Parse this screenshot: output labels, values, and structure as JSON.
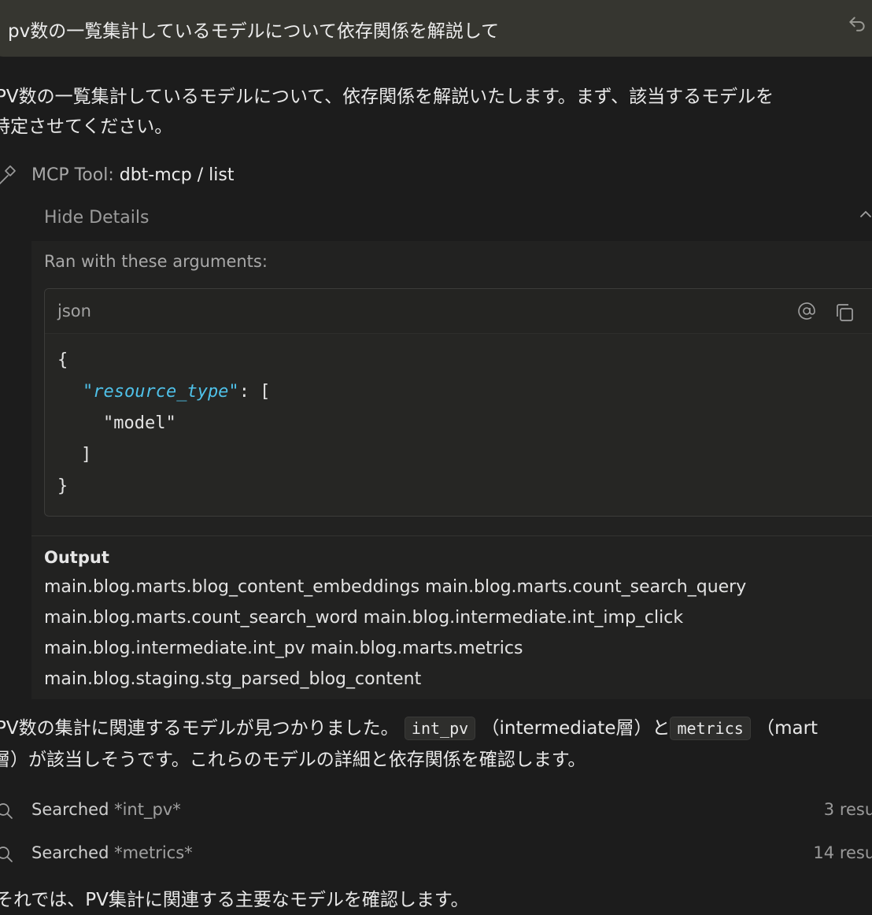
{
  "user_message": "pv数の一覧集計しているモデルについて依存関係を解説して",
  "assistant_intro_line1": "PV数の一覧集計しているモデルについて、依存関係を解説いたします。まず、該当するモデルを",
  "assistant_intro_line2": "特定させてください。",
  "tool_call": {
    "label": "MCP Tool:",
    "name": "dbt-mcp / list",
    "hide_details": "Hide Details",
    "ran_with": "Ran with these arguments:",
    "code_lang": "json",
    "code_lines": [
      "{",
      "\"resource_type\"",
      ": [",
      "\"model\"",
      "]",
      "}"
    ],
    "output_title": "Output",
    "output_lines": [
      "main.blog.marts.blog_content_embeddings main.blog.marts.count_search_query",
      "main.blog.marts.count_search_word main.blog.intermediate.int_imp_click",
      "main.blog.intermediate.int_pv main.blog.marts.metrics",
      "main.blog.staging.stg_parsed_blog_content"
    ]
  },
  "assistant_found": {
    "part1": "PV数の集計に関連するモデルが見つかりました。",
    "code1": "int_pv",
    "part2": "（intermediate層）と",
    "code2": "metrics",
    "part3": "（mart",
    "line2": "層）が該当しそうです。これらのモデルの詳細と依存関係を確認します。"
  },
  "searches": [
    {
      "label": "Searched",
      "query": "*int_pv*",
      "count": "3 resul"
    },
    {
      "label": "Searched",
      "query": "*metrics*",
      "count": "14 resul"
    }
  ],
  "trailing_text": "それでは、PV集計に関連する主要なモデルを確認します。"
}
